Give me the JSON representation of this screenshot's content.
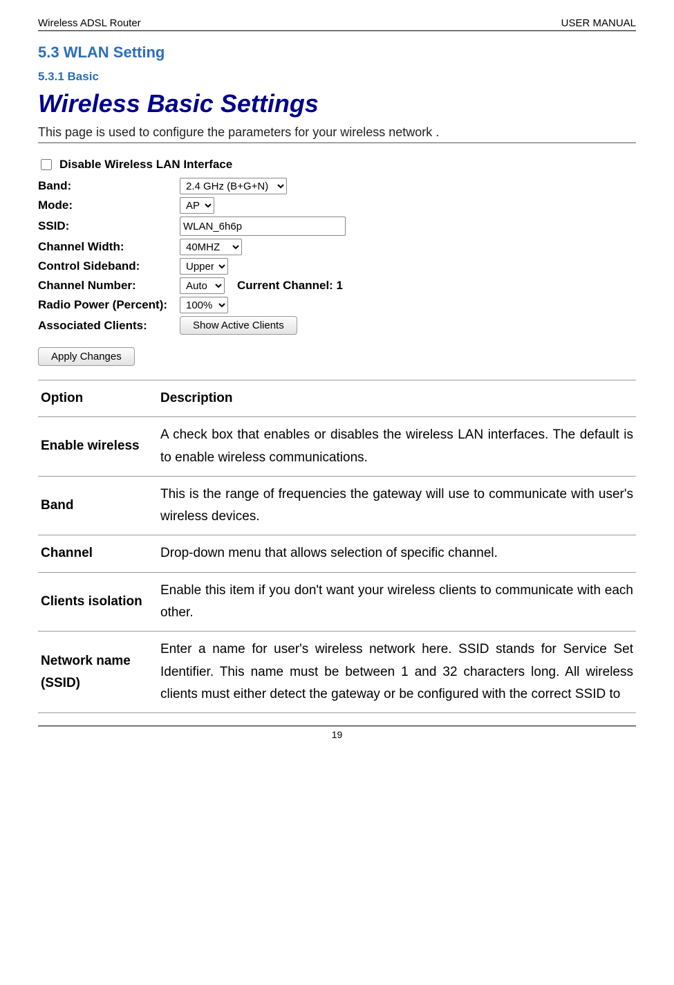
{
  "header": {
    "left": "Wireless ADSL Router",
    "right": "USER MANUAL"
  },
  "section": {
    "heading": "5.3 WLAN Setting",
    "subheading": "5.3.1 Basic"
  },
  "pageTitle": "Wireless Basic Settings",
  "intro": "This page is used to configure the parameters for your wireless network .",
  "form": {
    "disableLabel": "Disable Wireless LAN Interface",
    "band": {
      "label": "Band:",
      "value": "2.4 GHz (B+G+N)"
    },
    "mode": {
      "label": "Mode:",
      "value": "AP"
    },
    "ssid": {
      "label": "SSID:",
      "value": "WLAN_6h6p"
    },
    "channelWidth": {
      "label": "Channel Width:",
      "value": "40MHZ"
    },
    "sideband": {
      "label": "Control Sideband:",
      "value": "Upper"
    },
    "channelNumber": {
      "label": "Channel Number:",
      "value": "Auto"
    },
    "currentChannel": "Current Channel: 1",
    "radioPower": {
      "label": "Radio Power (Percent):",
      "value": "100%"
    },
    "associatedClients": {
      "label": "Associated Clients:",
      "button": "Show Active Clients"
    },
    "applyButton": "Apply Changes"
  },
  "table": {
    "head": {
      "option": "Option",
      "description": "Description"
    },
    "rows": [
      {
        "option": "Enable wireless",
        "description": "A check box that enables or disables the wireless LAN interfaces. The default is to enable wireless communications."
      },
      {
        "option": "Band",
        "description": "This is the range of frequencies the gateway will use to communicate with user's wireless devices."
      },
      {
        "option": "Channel",
        "description": "Drop-down menu that allows selection of specific channel."
      },
      {
        "option": "Clients isolation",
        "description": "Enable this item if you don't want your wireless clients to communicate with each other."
      },
      {
        "option": "Network name (SSID)",
        "description": "Enter a name for user's wireless network here. SSID stands for Service Set Identifier. This name must be between 1 and 32 characters long. All wireless clients must either detect the gateway or be configured with the correct SSID to"
      }
    ]
  },
  "pageNumber": "19"
}
